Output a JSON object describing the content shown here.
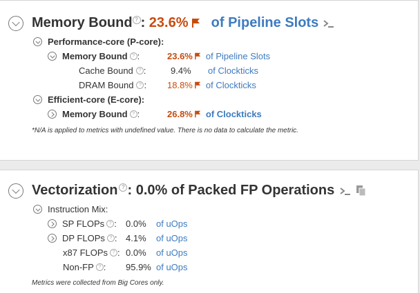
{
  "section1": {
    "title": "Memory Bound",
    "colon": ":",
    "value": "23.6%",
    "unit": "of Pipeline Slots",
    "pcore": {
      "label": "Performance-core (P-core):",
      "memory_bound": {
        "label": "Memory Bound",
        "value": "23.6%",
        "unit": "of Pipeline Slots"
      },
      "cache_bound": {
        "label": "Cache Bound",
        "value": "9.4%",
        "unit": "of Clockticks"
      },
      "dram_bound": {
        "label": "DRAM Bound",
        "value": "18.8%",
        "unit": "of Clockticks"
      }
    },
    "ecore": {
      "label": "Efficient-core (E-core):",
      "memory_bound": {
        "label": "Memory Bound",
        "value": "26.8%",
        "unit": "of Clockticks"
      }
    },
    "note": "*N/A is applied to metrics with undefined value. There is no data to calculate the metric."
  },
  "section2": {
    "title": "Vectorization",
    "colon": ":",
    "value_text": "0.0% of Packed FP Operations",
    "instruction_mix": {
      "label": "Instruction Mix:",
      "rows": [
        {
          "label": "SP FLOPs",
          "value": "0.0%",
          "unit": "of uOps"
        },
        {
          "label": "DP FLOPs",
          "value": "4.1%",
          "unit": "of uOps"
        },
        {
          "label": "x87 FLOPs",
          "value": "0.0%",
          "unit": "of uOps"
        },
        {
          "label": "Non-FP",
          "value": "95.9%",
          "unit": "of uOps"
        }
      ]
    },
    "note": "Metrics were collected from Big Cores only."
  },
  "help_glyph": "?",
  "colors": {
    "accent_red": "#c84b0e",
    "link_blue": "#3d7bbf"
  },
  "icons": [
    "chevron-toggle-icon",
    "help-icon",
    "flag-icon",
    "terminal-prompt-icon",
    "copy-icon"
  ]
}
